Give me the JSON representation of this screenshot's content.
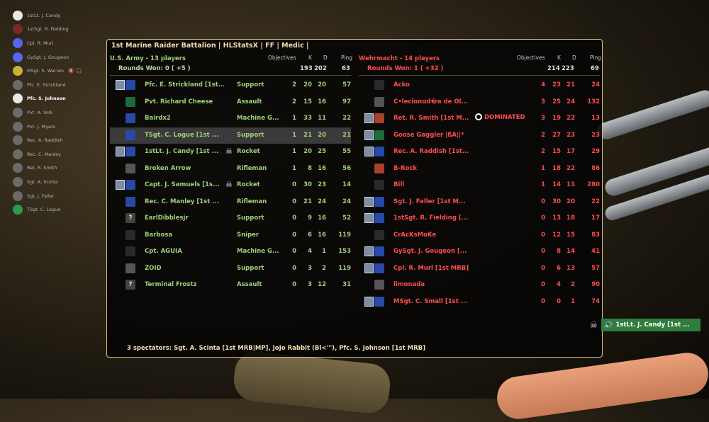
{
  "voice_list": [
    {
      "name": "1stLt. J. Candy",
      "avatar": "white",
      "active": false,
      "extra": ""
    },
    {
      "name": "1stSgt. R. Fielding",
      "avatar": "cross",
      "active": false,
      "extra": ""
    },
    {
      "name": "Cpl. R. Murl",
      "avatar": "blue",
      "active": false,
      "extra": ""
    },
    {
      "name": "GySgt. J. Gougeon",
      "avatar": "blue",
      "active": false,
      "extra": ""
    },
    {
      "name": "MSgt. S. Warren",
      "avatar": "yellow",
      "active": false,
      "extra": "🔇 🎧"
    },
    {
      "name": "Pfc. E. Strickland",
      "avatar": "gray",
      "active": false,
      "extra": ""
    },
    {
      "name": "Pfc. S. Johnson",
      "avatar": "white",
      "active": true,
      "extra": ""
    },
    {
      "name": "Pvt. A. York",
      "avatar": "gray",
      "active": false,
      "extra": ""
    },
    {
      "name": "Pvt. J. Myers",
      "avatar": "gray",
      "active": false,
      "extra": ""
    },
    {
      "name": "Rec. A. Raddish",
      "avatar": "gray",
      "active": false,
      "extra": ""
    },
    {
      "name": "Rec. C. Manley",
      "avatar": "gray",
      "active": false,
      "extra": ""
    },
    {
      "name": "Ret. R. Smith",
      "avatar": "gray",
      "active": false,
      "extra": ""
    },
    {
      "name": "Sgt. A. Scinta",
      "avatar": "gray",
      "active": false,
      "extra": ""
    },
    {
      "name": "Sgt. J. Faller",
      "avatar": "gray",
      "active": false,
      "extra": ""
    },
    {
      "name": "TSgt. C. Logue",
      "avatar": "green",
      "active": false,
      "extra": ""
    }
  ],
  "board": {
    "title": "1st Marine Raider Battalion | HLStatsX | FF | Medic |",
    "columns": {
      "objectives": "Objectives",
      "k": "K",
      "d": "D",
      "ping": "Ping"
    },
    "spectators": "3 spectators: Sgt. A. Scinta [1st MRB|MP], JoJo Rabbit (Bl<'''), Pfc. S. Johnson [1st MRB]"
  },
  "us_team": {
    "name": "U.S. Army   -   13 players",
    "rounds": "Rounds Won: 0 ( +5 )",
    "totals": {
      "k": "193",
      "d": "202",
      "ping": "63"
    },
    "players": [
      {
        "name": "Pfc. E. Strickland [1st...",
        "cls": "Support",
        "obj": "2",
        "k": "20",
        "d": "20",
        "ping": "57",
        "icon": "blue",
        "badge": true,
        "skull": false,
        "sel": false
      },
      {
        "name": "Pvt. Richard Cheese",
        "cls": "Assault",
        "obj": "2",
        "k": "15",
        "d": "16",
        "ping": "97",
        "icon": "green",
        "badge": false,
        "skull": false,
        "sel": false
      },
      {
        "name": "Bairdx2",
        "cls": "Machine G...",
        "obj": "1",
        "k": "33",
        "d": "11",
        "ping": "22",
        "icon": "blue",
        "badge": false,
        "skull": false,
        "sel": false
      },
      {
        "name": "TSgt. C. Logue [1st ...",
        "cls": "Support",
        "obj": "1",
        "k": "21",
        "d": "20",
        "ping": "21",
        "icon": "blue",
        "badge": false,
        "skull": false,
        "sel": true
      },
      {
        "name": "1stLt. J. Candy [1st ...",
        "cls": "Rocket",
        "obj": "1",
        "k": "20",
        "d": "25",
        "ping": "55",
        "icon": "blue",
        "badge": true,
        "skull": true,
        "sel": false
      },
      {
        "name": "Broken Arrow",
        "cls": "Rifleman",
        "obj": "1",
        "k": "8",
        "d": "16",
        "ping": "56",
        "icon": "gray",
        "badge": false,
        "skull": false,
        "sel": false
      },
      {
        "name": "Capt. J. Samuels [1s...",
        "cls": "Rocket",
        "obj": "0",
        "k": "30",
        "d": "23",
        "ping": "14",
        "icon": "blue",
        "badge": true,
        "skull": true,
        "sel": false
      },
      {
        "name": "Rec. C. Manley [1st ...",
        "cls": "Rifleman",
        "obj": "0",
        "k": "21",
        "d": "24",
        "ping": "24",
        "icon": "blue",
        "badge": false,
        "skull": false,
        "sel": false
      },
      {
        "name": "EarlDibblesjr",
        "cls": "Support",
        "obj": "0",
        "k": "9",
        "d": "16",
        "ping": "52",
        "icon": "q",
        "badge": false,
        "skull": false,
        "sel": false
      },
      {
        "name": "Barbosa",
        "cls": "Sniper",
        "obj": "0",
        "k": "6",
        "d": "16",
        "ping": "119",
        "icon": "dark",
        "badge": false,
        "skull": false,
        "sel": false
      },
      {
        "name": "Cpt. ÁGUIA",
        "cls": "Machine G...",
        "obj": "0",
        "k": "4",
        "d": "1",
        "ping": "153",
        "icon": "dark",
        "badge": false,
        "skull": false,
        "sel": false
      },
      {
        "name": "ZOID",
        "cls": "Support",
        "obj": "0",
        "k": "3",
        "d": "2",
        "ping": "119",
        "icon": "gray",
        "badge": false,
        "skull": false,
        "sel": false
      },
      {
        "name": "Terminal Frostz",
        "cls": "Assault",
        "obj": "0",
        "k": "3",
        "d": "12",
        "ping": "31",
        "icon": "q",
        "badge": false,
        "skull": false,
        "sel": false
      }
    ]
  },
  "de_team": {
    "name": "Wehrmacht   -   14 players",
    "rounds": "Rounds Won: 1 ( +32 )",
    "totals": {
      "k": "214",
      "d": "223",
      "ping": "69"
    },
    "players": [
      {
        "name": "Acko",
        "dom": "",
        "obj": "4",
        "k": "23",
        "d": "21",
        "ping": "24",
        "icon": "dark",
        "badge": false
      },
      {
        "name": "C•lecionɑd�a de Ol...",
        "dom": "",
        "obj": "3",
        "k": "25",
        "d": "24",
        "ping": "132",
        "icon": "gray",
        "badge": false
      },
      {
        "name": "Ret. R. Smith [1st M...",
        "dom": "DOMINATED",
        "obj": "3",
        "k": "19",
        "d": "22",
        "ping": "13",
        "icon": "red",
        "badge": true
      },
      {
        "name": "Goose Gaggler |ßÅ¦|*",
        "dom": "",
        "obj": "2",
        "k": "27",
        "d": "23",
        "ping": "23",
        "icon": "green",
        "badge": true
      },
      {
        "name": "Rec. A. Raddish [1st...",
        "dom": "",
        "obj": "2",
        "k": "15",
        "d": "17",
        "ping": "29",
        "icon": "blue",
        "badge": true
      },
      {
        "name": "B-Rock",
        "dom": "",
        "obj": "1",
        "k": "18",
        "d": "22",
        "ping": "86",
        "icon": "red",
        "badge": false
      },
      {
        "name": "Bill",
        "dom": "",
        "obj": "1",
        "k": "14",
        "d": "11",
        "ping": "280",
        "icon": "dark",
        "badge": false
      },
      {
        "name": "Sgt. J. Faller [1st M...",
        "dom": "",
        "obj": "0",
        "k": "30",
        "d": "20",
        "ping": "22",
        "icon": "blue",
        "badge": true
      },
      {
        "name": "1stSgt. R. Fielding [...",
        "dom": "",
        "obj": "0",
        "k": "13",
        "d": "18",
        "ping": "17",
        "icon": "blue",
        "badge": true
      },
      {
        "name": "CrAcKsMoKe",
        "dom": "",
        "obj": "0",
        "k": "12",
        "d": "15",
        "ping": "83",
        "icon": "dark",
        "badge": false
      },
      {
        "name": "GySgt. J. Gougeon [...",
        "dom": "",
        "obj": "0",
        "k": "8",
        "d": "14",
        "ping": "41",
        "icon": "blue",
        "badge": true
      },
      {
        "name": "Cpl. R. Murl [1st MRB]",
        "dom": "",
        "obj": "0",
        "k": "6",
        "d": "13",
        "ping": "57",
        "icon": "blue",
        "badge": true
      },
      {
        "name": "limonada",
        "dom": "",
        "obj": "0",
        "k": "4",
        "d": "2",
        "ping": "90",
        "icon": "gray",
        "badge": false
      },
      {
        "name": "MSgt. C. Small [1st ...",
        "dom": "",
        "obj": "0",
        "k": "0",
        "d": "1",
        "ping": "74",
        "icon": "blue",
        "badge": true
      }
    ]
  },
  "speaking": {
    "name": "1stLt. J. Candy [1st ...",
    "icon": "speaker-icon"
  }
}
